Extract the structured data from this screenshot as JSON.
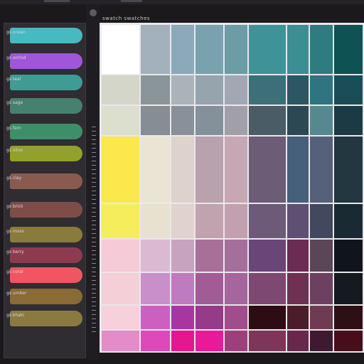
{
  "panel": {
    "title": "swatch swatches"
  },
  "sidebar": {
    "items": [
      {
        "label": "gs ocean",
        "color": "#47b9c1"
      },
      {
        "label": "gs orchid",
        "color": "#a056d8"
      },
      {
        "label": "gs teal",
        "color": "#3f9c95"
      },
      {
        "label": "gs sage",
        "color": "#46806e"
      },
      {
        "label": "gs fern",
        "color": "#3d8f68"
      },
      {
        "label": "gs olive",
        "color": "#93a02a"
      },
      {
        "label": "gs clay",
        "color": "#8b5a4f"
      },
      {
        "label": "gs brick",
        "color": "#7e4d48"
      },
      {
        "label": "gs moss",
        "color": "#8a7a3c"
      },
      {
        "label": "gs berry",
        "color": "#8e3b50"
      },
      {
        "label": "gs coral",
        "color": "#ef5662"
      },
      {
        "label": "gs umber",
        "color": "#8a6a35"
      },
      {
        "label": "gs khaki",
        "color": "#8b7a3f"
      }
    ]
  },
  "palette": {
    "columns": 9,
    "rows": 9,
    "colors": [
      [
        "#ffffff",
        "#a2b1bb",
        "#8ba9b8",
        "#7aa1ae",
        "#6c9ca6",
        "#3f9398",
        "#3b8e92",
        "#2e7b80",
        "#0f5253"
      ],
      [
        "#d3d6c8",
        "#8a959a",
        "#aab4b8",
        "#95a4ad",
        "#a1a8b4",
        "#3d6f78",
        "#2b5762",
        "#2e7481",
        "#1b4d56"
      ],
      [
        "#dcdfcd",
        "#868d95",
        "#889099",
        "#84919a",
        "#a19fa8",
        "#4a5d66",
        "#2c4852",
        "#56888f",
        "#1b3a43"
      ],
      [
        "#fbe84c",
        "#eae4d4",
        "#ddd3cc",
        "#b8a2ad",
        "#c6a7b3",
        "#6c5c76",
        "#465f7b",
        "#55617a",
        "#22373f"
      ],
      [
        "#f5ed5c",
        "#e8e1cf",
        "#dfd2cf",
        "#c0a3ae",
        "#c3a0b0",
        "#6d5a78",
        "#5f5073",
        "#42485d",
        "#1a2a33"
      ],
      [
        "#f6cad6",
        "#dcb9d2",
        "#c8a3c0",
        "#a86f99",
        "#a46f9a",
        "#6a4578",
        "#6b2b53",
        "#5a4656",
        "#10141c"
      ],
      [
        "#f5cfd8",
        "#c98fca",
        "#be7bbd",
        "#a15c96",
        "#a5659d",
        "#7d4871",
        "#6e3152",
        "#6c4060",
        "#141a1f"
      ],
      [
        "#f6d0da",
        "#cd5fc1",
        "#a936a0",
        "#963a8a",
        "#a14d8c",
        "#2d0c14",
        "#4d1c2a",
        "#6f3b52",
        "#2d0f14"
      ],
      [
        "#e48bc9",
        "#df48ba",
        "#e4178e",
        "#e9199a",
        "#9d3f7a",
        "#7d3658",
        "#69284b",
        "#40182f",
        "#480d1a"
      ]
    ]
  },
  "colors": {
    "background": "#1b191c",
    "sidebar_bg": "#2f2d31",
    "grid_line": "#e9e8ea"
  }
}
